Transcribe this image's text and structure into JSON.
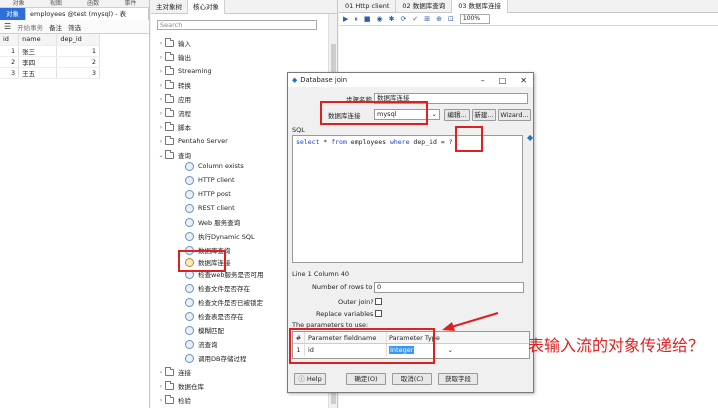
{
  "left": {
    "top_tabs": [
      "对象",
      "视图",
      "函数",
      "事件"
    ],
    "active_tab": "对象",
    "doc_tab": "employees @test (mysql) - 表",
    "toolbar": {
      "begin_tx": "开始事务",
      "note": "备注",
      "filter": "筛选"
    },
    "columns": [
      "id",
      "name",
      "dep_id"
    ],
    "rows": [
      [
        "1",
        "张三",
        "1"
      ],
      [
        "2",
        "李四",
        "2"
      ],
      [
        "3",
        "王五",
        "3"
      ]
    ]
  },
  "middle": {
    "tabs": [
      "主对象树",
      "核心对象"
    ],
    "search_placeholder": "Search",
    "folders_top": [
      "输入",
      "输出",
      "Streaming",
      "转换",
      "应用",
      "流程",
      "脚本",
      "Pentaho Server",
      "查询"
    ],
    "steps": [
      "Column exists",
      "HTTP client",
      "HTTP post",
      "REST client",
      "Web 服务查询",
      "执行Dynamic SQL",
      "数据库查询",
      "数据库连接",
      "检查web服务是否可用",
      "检查文件是否存在",
      "检查文件是否已被锁定",
      "检查表是否存在",
      "模糊匹配",
      "流查询",
      "调用DB存储过程"
    ],
    "folders_bottom": [
      "连接",
      "数据仓库",
      "检验"
    ]
  },
  "canvas": {
    "tabs": [
      "01 Http client",
      "02 数据库查询",
      "03 数据库连接"
    ],
    "zoom": "100%"
  },
  "dialog": {
    "title": "Database join",
    "step_name_label": "步骤名称",
    "step_name_value": "数据库连接",
    "connection_label": "数据库连接",
    "connection_value": "mysql",
    "edit_btn": "编辑...",
    "new_btn": "新建...",
    "wizard_btn": "Wizard...",
    "sql_label": "SQL",
    "sql_keyword1": "select",
    "sql_mid1": " * ",
    "sql_keyword2": "from",
    "sql_mid2": " employees ",
    "sql_keyword3": "where",
    "sql_tail": " dep_id = ?",
    "cursor_pos": "Line 1 Column 40",
    "rows_label": "Number of rows to",
    "rows_value": "0",
    "outer_join_label": "Outer join?",
    "replace_vars_label": "Replace variables",
    "params_label": "The parameters to use:",
    "param_cols": [
      "#",
      "Parameter fieldname",
      "Parameter Type"
    ],
    "param_row": [
      "1",
      "id",
      "Integer"
    ],
    "help_btn": "Help",
    "ok_btn": "确定(O)",
    "cancel_btn": "取消(C)",
    "getfields_btn": "获取字段"
  },
  "annotation": "表输入流的对象传递给？"
}
